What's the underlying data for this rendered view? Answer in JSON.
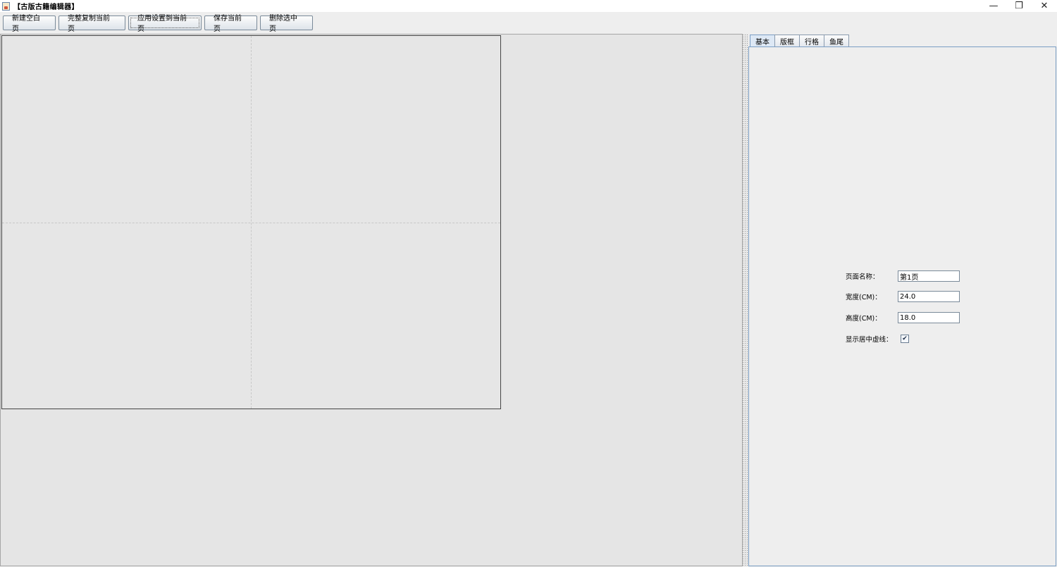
{
  "window": {
    "title": "【古版古籍编辑器】",
    "minimize_glyph": "—",
    "restore_glyph": "❐",
    "close_glyph": "✕"
  },
  "toolbar": {
    "buttons": [
      "新建空白页",
      "完整复制当前页",
      "应用设置到当前页",
      "保存当前页",
      "删除选中页"
    ]
  },
  "panel": {
    "tabs": [
      "基本",
      "版框",
      "行格",
      "鱼尾"
    ],
    "active_tab": "基本",
    "form": {
      "page_name_label": "页面名称：",
      "page_name_value": "第1页",
      "width_label": "宽度(CM)：",
      "width_value": "24.0",
      "height_label": "高度(CM)：",
      "height_value": "18.0",
      "center_guides_label": "显示居中虚线：",
      "center_guides_checked": true,
      "check_glyph": "✔"
    }
  }
}
